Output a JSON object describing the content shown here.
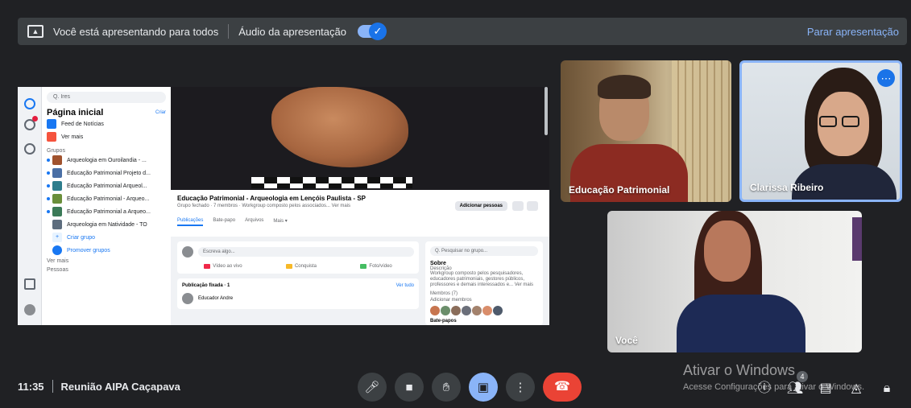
{
  "banner": {
    "presenting_text": "Você está apresentando para todos",
    "audio_label": "Áudio da apresentação",
    "audio_enabled": true,
    "stop_label": "Parar apresentação"
  },
  "shared_screen": {
    "search_placeholder": "Q. Ires",
    "home_title": "Página inicial",
    "create_label": "Criar",
    "nav_items": [
      "Feed de Notícias",
      "Ver mais"
    ],
    "groups_heading": "Grupos",
    "groups": [
      "Arqueologia em Ouroilandia - ...",
      "Educação Patrimonial Projeto d...",
      "Educação Patrimonial Arqueol...",
      "Educação Patrimonial - Arqueo...",
      "Educação Patrimonial a Arqueo...",
      "Arqueologia em Natividade - TO"
    ],
    "create_group": "Criar grupo",
    "promote_groups": "Promover grupos",
    "see_more": "Ver mais",
    "people_heading": "Pessoas",
    "group_title": "Educação Patrimonial - Arqueologia em Lençóis Paulista - SP",
    "group_subtitle": "Grupo fechado · 7 membros · Workgroup composto pelos associados... Ver mais",
    "tabs": [
      "Publicações",
      "Bate-papo",
      "Arquivos",
      "Mais ▾"
    ],
    "add_people": "Adicionar pessoas",
    "write_placeholder": "Escreva algo...",
    "post_actions": [
      "Vídeo ao vivo",
      "Conquista",
      "Foto/vídeo"
    ],
    "pinned_heading": "Publicação fixada · 1",
    "pinned_link": "Ver tudo",
    "post_author": "Educador Andre",
    "right_search": "Q. Pesquisar no grupo...",
    "about_title": "Sobre",
    "about_label": "Descrição",
    "about_text": "Workgroup composto pelos pesquisadores, educadores patrimoniais, gestores públicos, professores e demais interessados e... Ver mais",
    "members_label": "Membros (7)",
    "add_members": "Adicionar membros",
    "chat_label": "Bate-papos"
  },
  "participants": {
    "tile1_name": "Educação Patrimonial",
    "tile2_name": "Clarissa Ribeiro",
    "tile3_name": "Você",
    "more_icon": "⋯"
  },
  "watermark": {
    "title": "Ativar o Windows",
    "subtitle": "Acesse Configurações para ativar o Windows."
  },
  "bottom": {
    "time": "11:35",
    "meeting_name": "Reunião AIPA Caçapava",
    "participant_count": "4"
  },
  "icons": {
    "mic": "mic-icon",
    "camera": "camera-icon",
    "hand": "raise-hand-icon",
    "present": "present-screen-icon",
    "more": "more-vert-icon",
    "end_call": "end-call-icon",
    "info": "info-icon",
    "people": "people-icon",
    "chat": "chat-icon",
    "activities": "activities-icon",
    "host": "host-controls-icon"
  },
  "colors": {
    "accent": "#8ab4f8",
    "blue": "#1a73e8",
    "end_call": "#ea4335",
    "background": "#202124",
    "surface": "#3c4043"
  }
}
